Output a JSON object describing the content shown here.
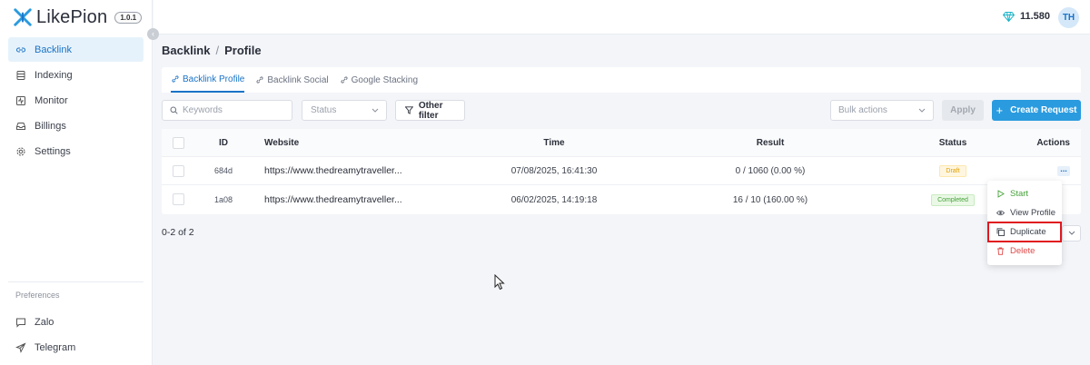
{
  "brand": {
    "name": "LikePion",
    "version": "1.0.1"
  },
  "sidebar": {
    "items": [
      {
        "label": "Backlink",
        "icon": "link-icon",
        "active": true
      },
      {
        "label": "Indexing",
        "icon": "database-icon",
        "active": false
      },
      {
        "label": "Monitor",
        "icon": "pulse-icon",
        "active": false
      },
      {
        "label": "Billings",
        "icon": "inbox-icon",
        "active": false
      },
      {
        "label": "Settings",
        "icon": "gear-icon",
        "active": false
      }
    ],
    "preferences_title": "Preferences",
    "preferences": [
      {
        "label": "Zalo",
        "icon": "chat-icon"
      },
      {
        "label": "Telegram",
        "icon": "send-icon"
      }
    ]
  },
  "header": {
    "credits": "11.580",
    "avatar": "TH"
  },
  "breadcrumb": {
    "section": "Backlink",
    "separator": "/",
    "page": "Profile"
  },
  "tabs": [
    {
      "label": "Backlink Profile",
      "active": true
    },
    {
      "label": "Backlink Social",
      "active": false
    },
    {
      "label": "Google Stacking",
      "active": false
    }
  ],
  "toolbar": {
    "search_placeholder": "Keywords",
    "status_placeholder": "Status",
    "filter_label": "Other filter",
    "bulk_placeholder": "Bulk actions",
    "apply_label": "Apply",
    "create_label": "Create Request"
  },
  "table": {
    "headers": {
      "id": "ID",
      "website": "Website",
      "time": "Time",
      "result": "Result",
      "status": "Status",
      "actions": "Actions"
    },
    "rows": [
      {
        "id": "684d",
        "website": "https://www.thedreamytraveller...",
        "time": "07/08/2025, 16:41:30",
        "result": "0 / 1060 (0.00 %)",
        "status": "Draft"
      },
      {
        "id": "1a08",
        "website": "https://www.thedreamytraveller...",
        "time": "06/02/2025, 14:19:18",
        "result": "16 / 10 (160.00 %)",
        "status": "Completed"
      }
    ],
    "more_label": "..."
  },
  "pagination": {
    "info": "0-2 of 2"
  },
  "actions_menu": [
    {
      "label": "Start",
      "icon": "play-icon"
    },
    {
      "label": "View Profile",
      "icon": "eye-icon"
    },
    {
      "label": "Duplicate",
      "icon": "copy-icon",
      "highlighted": true
    },
    {
      "label": "Delete",
      "icon": "trash-icon"
    }
  ],
  "colors": {
    "accent": "#2a9bdf",
    "active_link": "#1a73c7",
    "highlight_box": "#e0181f",
    "draft": "#e0a100",
    "completed": "#46a23a",
    "danger": "#e04848"
  }
}
